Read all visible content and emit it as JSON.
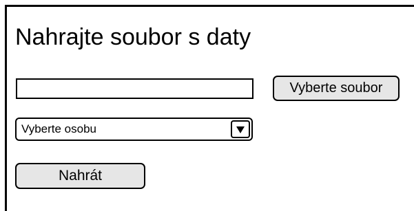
{
  "form": {
    "title": "Nahrajte soubor s daty",
    "file_input": {
      "value": "",
      "placeholder": ""
    },
    "browse_button_label": "Vyberte soubor",
    "person_select": {
      "selected_label": "Vyberte osobu",
      "arrow_icon": "triangle-down-icon"
    },
    "upload_button_label": "Nahrát"
  }
}
